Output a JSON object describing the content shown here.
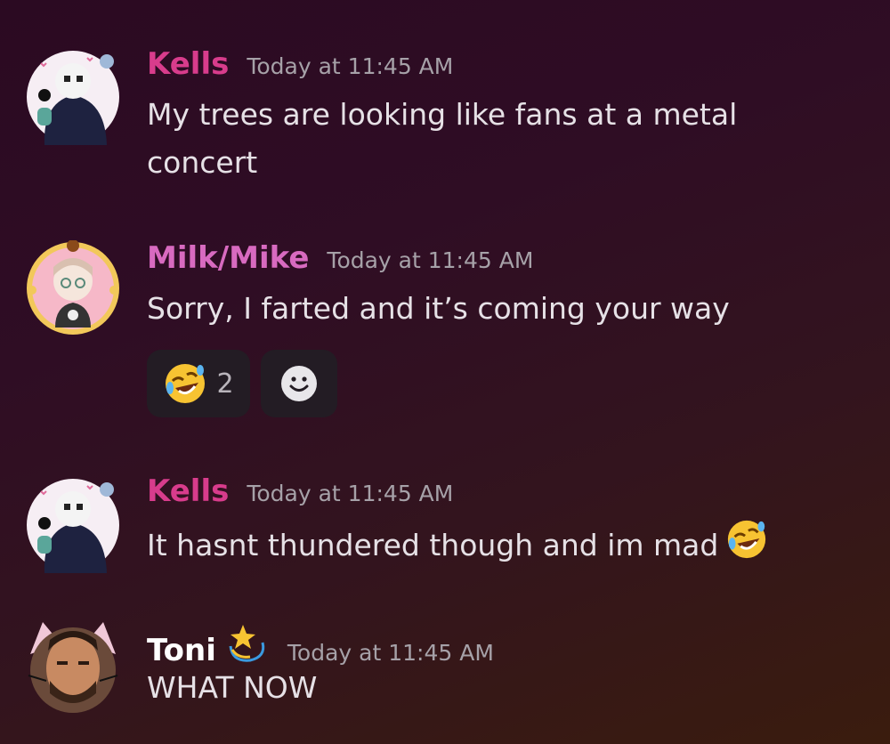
{
  "colors": {
    "kells_name": "#d83c8c",
    "milk_name": "#d86ac0",
    "toni_name": "#ffffff",
    "timestamp": "#a6a1a8",
    "text": "#e6e1e6",
    "reaction_bg": "#231c24"
  },
  "messages": [
    {
      "username": "Kells",
      "timestamp": "Today at 11:45 AM",
      "text": "My trees are looking like fans at a metal concert"
    },
    {
      "username": "Milk/Mike",
      "timestamp": "Today at 11:45 AM",
      "text": "Sorry, I farted and it’s coming your way",
      "reactions": [
        {
          "emoji": "rolling-on-floor-laughing-emoji",
          "count": "2"
        },
        {
          "emoji": "add-reaction-smiley-icon"
        }
      ]
    },
    {
      "username": "Kells",
      "timestamp": "Today at 11:45 AM",
      "text": "It hasnt thundered though and im mad",
      "trailing_emoji": "rolling-on-floor-laughing-emoji"
    },
    {
      "username": "Toni",
      "username_emoji": "dizzy-emoji",
      "timestamp": "Today at 11:45 AM",
      "text": "WHAT NOW"
    }
  ]
}
